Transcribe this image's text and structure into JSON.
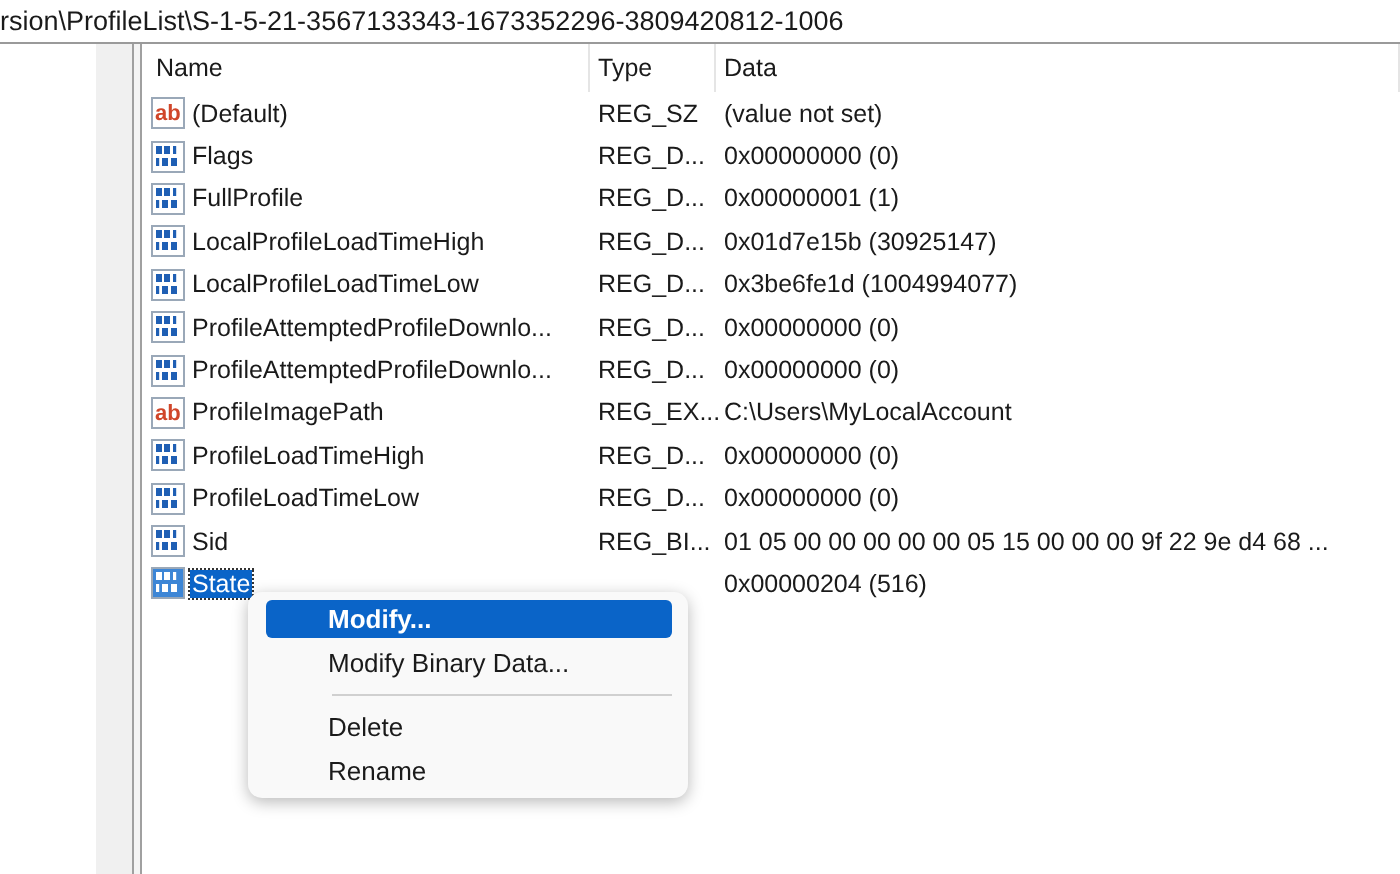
{
  "address_bar": {
    "path": "rsion\\ProfileList\\S-1-5-21-3567133343-1673352296-3809420812-1006"
  },
  "table": {
    "columns": [
      "Name",
      "Type",
      "Data"
    ],
    "rows": [
      {
        "kind": "string",
        "icon": "ab",
        "name": "(Default)",
        "type": "REG_SZ",
        "data": "(value not set)",
        "selected": false
      },
      {
        "kind": "binary",
        "name": "Flags",
        "type": "REG_D...",
        "data": "0x00000000 (0)",
        "selected": false
      },
      {
        "kind": "binary",
        "name": "FullProfile",
        "type": "REG_D...",
        "data": "0x00000001 (1)",
        "selected": false
      },
      {
        "kind": "binary",
        "name": "LocalProfileLoadTimeHigh",
        "type": "REG_D...",
        "data": "0x01d7e15b (30925147)",
        "selected": false
      },
      {
        "kind": "binary",
        "name": "LocalProfileLoadTimeLow",
        "type": "REG_D...",
        "data": "0x3be6fe1d (1004994077)",
        "selected": false
      },
      {
        "kind": "binary",
        "name": "ProfileAttemptedProfileDownlo...",
        "type": "REG_D...",
        "data": "0x00000000 (0)",
        "selected": false
      },
      {
        "kind": "binary",
        "name": "ProfileAttemptedProfileDownlo...",
        "type": "REG_D...",
        "data": "0x00000000 (0)",
        "selected": false
      },
      {
        "kind": "string",
        "icon": "ab",
        "name": "ProfileImagePath",
        "type": "REG_EX...",
        "data": "C:\\Users\\MyLocalAccount",
        "selected": false
      },
      {
        "kind": "binary",
        "name": "ProfileLoadTimeHigh",
        "type": "REG_D...",
        "data": "0x00000000 (0)",
        "selected": false
      },
      {
        "kind": "binary",
        "name": "ProfileLoadTimeLow",
        "type": "REG_D...",
        "data": "0x00000000 (0)",
        "selected": false
      },
      {
        "kind": "binary",
        "name": "Sid",
        "type": "REG_BI...",
        "data": "01 05 00 00 00 00 00 05 15 00 00 00 9f 22 9e d4 68 ...",
        "selected": false
      },
      {
        "kind": "binary",
        "name": "State",
        "data": "0x00000204 (516)",
        "selected": true
      }
    ]
  },
  "context_menu": {
    "items": [
      {
        "kind": "item",
        "label": "Modify...",
        "selected": true
      },
      {
        "kind": "item",
        "label": "Modify Binary Data...",
        "selected": false
      },
      {
        "kind": "separator"
      },
      {
        "kind": "item",
        "label": "Delete",
        "selected": false
      },
      {
        "kind": "item",
        "label": "Rename",
        "selected": false
      }
    ]
  }
}
